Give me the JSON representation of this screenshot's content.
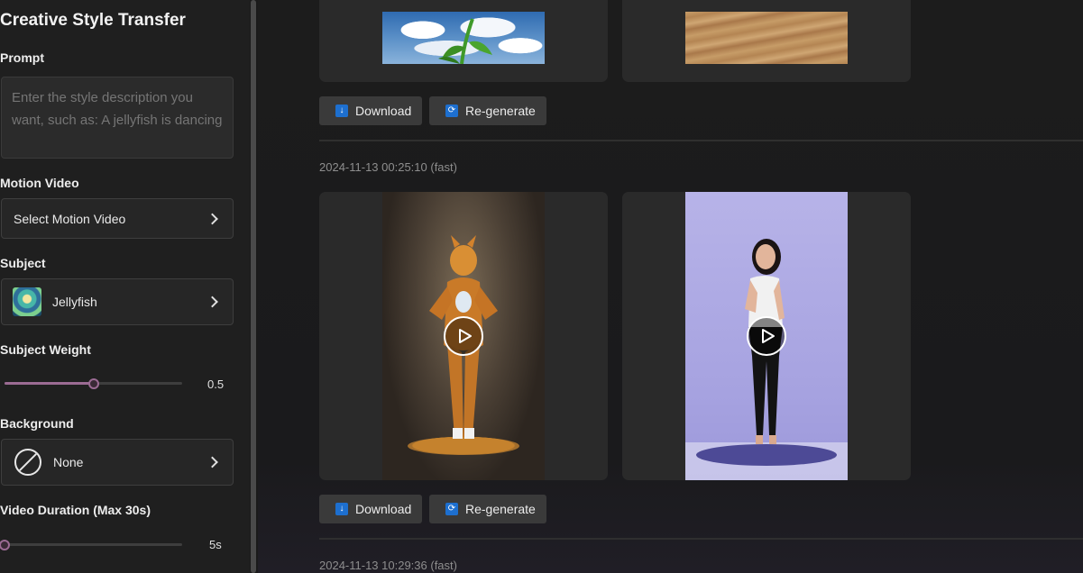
{
  "sidebar": {
    "title": "Creative Style Transfer",
    "prompt": {
      "label": "Prompt",
      "placeholder": "Enter the style description you want, such as: A jellyfish is dancing"
    },
    "motion_video": {
      "label": "Motion Video",
      "value": "Select Motion Video"
    },
    "subject": {
      "label": "Subject",
      "value": "Jellyfish"
    },
    "subject_weight": {
      "label": "Subject Weight",
      "value": 0.5,
      "display": "0.5"
    },
    "background": {
      "label": "Background",
      "value": "None"
    },
    "video_duration": {
      "label": "Video Duration (Max 30s)",
      "value": 5,
      "display": "5s"
    },
    "accent_color": "#9b6b93"
  },
  "results": {
    "groups": [
      {
        "timestamp": "",
        "buttons": {
          "download": "Download",
          "regenerate": "Re-generate"
        }
      },
      {
        "timestamp": "2024-11-13 00:25:10 (fast)",
        "buttons": {
          "download": "Download",
          "regenerate": "Re-generate"
        }
      },
      {
        "timestamp": "2024-11-13 10:29:36 (fast)"
      }
    ]
  },
  "icons": {
    "download": "download-icon",
    "regenerate": "refresh-icon",
    "play": "play-icon",
    "chevron": "chevron-right-icon",
    "none": "prohibited-icon"
  }
}
